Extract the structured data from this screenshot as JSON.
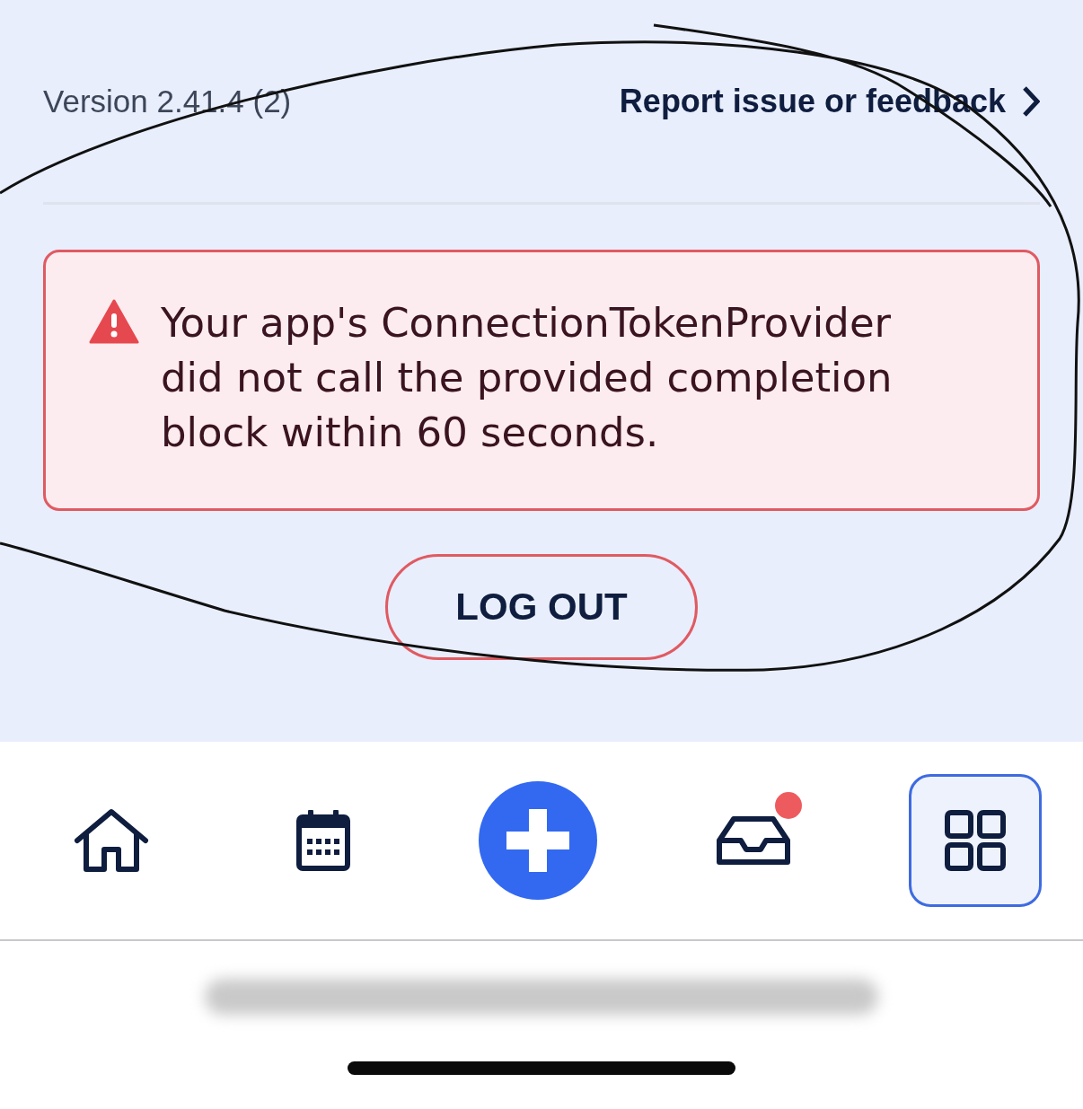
{
  "header": {
    "version": "Version 2.41.4 (2)",
    "feedback_link": "Report issue or feedback"
  },
  "error": {
    "message": "Your app's ConnectionTokenProvider did not call the provided completion block within 60 seconds."
  },
  "logout_button": "LOG OUT",
  "tab_bar": [
    {
      "kind": "home",
      "selected": false,
      "badge": false
    },
    {
      "kind": "calendar",
      "selected": false,
      "badge": false
    },
    {
      "kind": "add",
      "selected": false,
      "badge": false
    },
    {
      "kind": "inbox",
      "selected": false,
      "badge": true
    },
    {
      "kind": "grid",
      "selected": true,
      "badge": false
    }
  ]
}
